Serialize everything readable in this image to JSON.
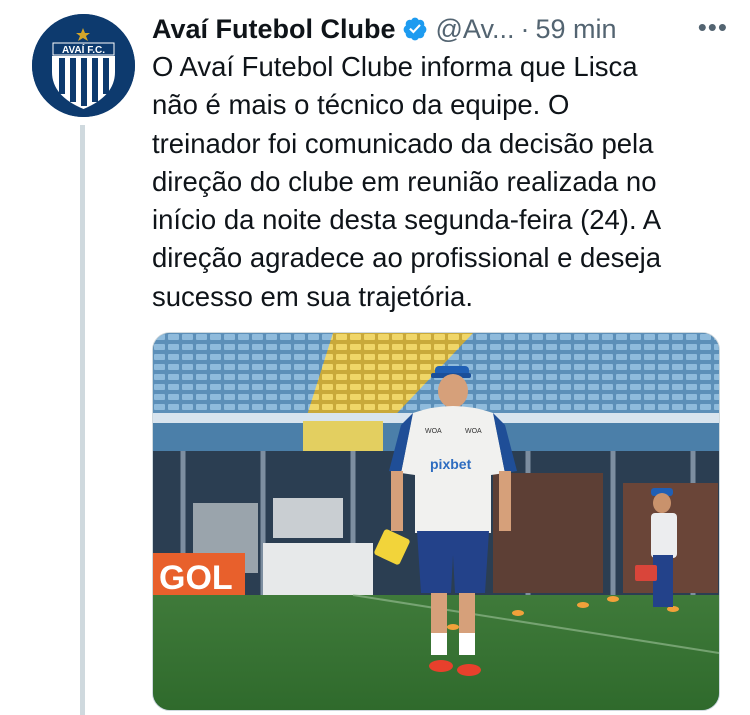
{
  "tweet": {
    "author_name": "Avaí Futebol Clube",
    "author_handle": "@Av...",
    "separator": "·",
    "timestamp": "59 min",
    "more_label": "•••",
    "avatar_text": "AVAÍ F.C.",
    "text_lines": [
      "O Avaí Futebol Clube informa que Lisca",
      "não é mais o técnico da equipe. O",
      "treinador foi comunicado da decisão pela",
      "direção do clube em reunião realizada no",
      "início da noite desta segunda-feira (24). A",
      "direção agradece ao profissional e deseja",
      "sucesso em sua trajetória."
    ],
    "media": {
      "shirt_sponsor": "pixbet",
      "shirt_badges": [
        "WOA",
        "WOA"
      ],
      "ad_board": "GOL"
    }
  },
  "colors": {
    "verified": "#1d9bf0",
    "secondary_text": "#536471",
    "thread_line": "#cfd9de",
    "club_blue": "#0d3a6e"
  }
}
